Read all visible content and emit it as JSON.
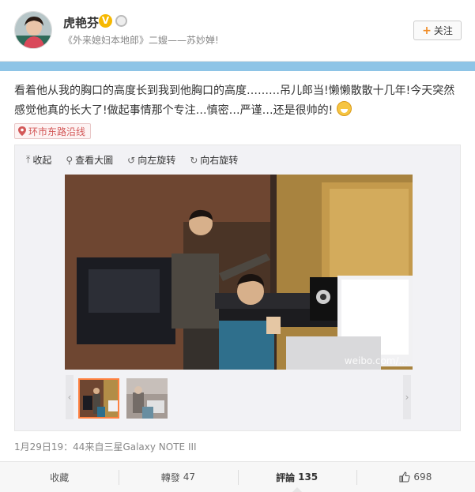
{
  "user": {
    "name": "虎艳芬",
    "verified_badge": "V",
    "subtitle": "《外来媳妇本地郎》二嫂——苏妙婵!",
    "avatar_icon": "user-avatar"
  },
  "follow": {
    "label": "关注",
    "icon": "plus-icon"
  },
  "post": {
    "text": "看着他从我的胸口的高度长到我到他胸口的高度………吊儿郎当!懒懒散散十几年!今天突然感觉他真的长大了!做起事情那个专注…慎密…严谨…还是很帅的!",
    "emoji_icon": "grin-emoji-icon",
    "location": "环市东路沿线"
  },
  "media": {
    "toolbar": {
      "collapse": "收起",
      "view_large": "查看大圖",
      "rotate_left": "向左旋转",
      "rotate_right": "向右旋转"
    },
    "watermark_line1": "@...",
    "watermark_line2": "weibo.com/...",
    "thumb_prev": "‹",
    "thumb_next": "›"
  },
  "meta": {
    "time_source": "1月29日19：44来自三星Galaxy NOTE III"
  },
  "actions": {
    "favorite": "收藏",
    "repost_label": "轉發",
    "repost_count": "47",
    "comment_label": "評論",
    "comment_count": "135",
    "like_count": "698"
  },
  "colors": {
    "accent": "#f08b24",
    "stripe": "#8ec4e6",
    "location": "#d35858",
    "thumb_border": "#ff8140"
  }
}
